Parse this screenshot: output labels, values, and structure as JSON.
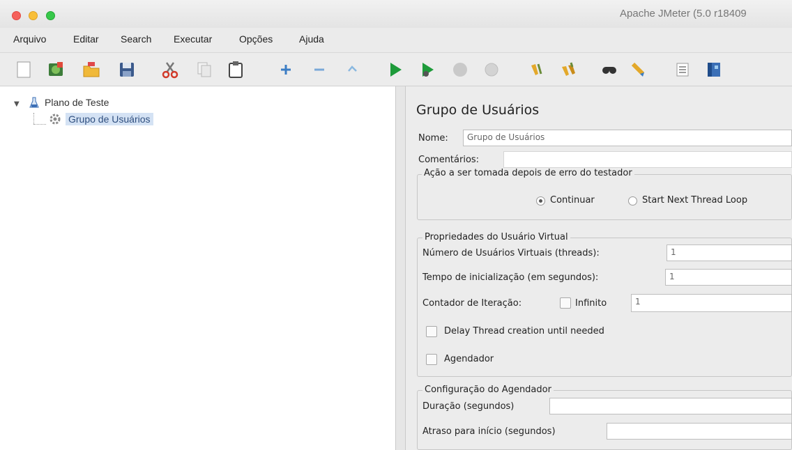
{
  "window": {
    "title": "Apache JMeter (5.0 r18409"
  },
  "menu": {
    "items": [
      {
        "label": "Arquivo"
      },
      {
        "label": "Editar"
      },
      {
        "label": "Search"
      },
      {
        "label": "Executar"
      },
      {
        "label": "Opções"
      },
      {
        "label": "Ajuda"
      }
    ]
  },
  "toolbar": {
    "icons": [
      "new-icon",
      "templates-icon",
      "open-icon",
      "save-icon",
      "cut-icon",
      "copy-icon",
      "paste-icon",
      "expand-icon",
      "collapse-icon",
      "toggle-icon",
      "start-icon",
      "start-no-pause-icon",
      "stop-icon",
      "shutdown-icon",
      "clear-icon",
      "clear-all-icon",
      "search-icon",
      "reset-search-icon",
      "function-helper-icon",
      "help-icon"
    ]
  },
  "tree": {
    "root": {
      "label": "Plano de Teste"
    },
    "child": {
      "label": "Grupo de Usuários"
    }
  },
  "panel": {
    "title": "Grupo de Usuários",
    "name_label": "Nome:",
    "name_value": "Grupo de Usuários",
    "comments_label": "Comentários:",
    "error_action": {
      "legend": "Ação a ser tomada depois de erro do testador",
      "continue_label": "Continuar",
      "next_loop_label": "Start Next Thread Loop"
    },
    "thread_props": {
      "legend": "Propriedades do Usuário Virtual",
      "threads_label": "Número de Usuários Virtuais (threads):",
      "threads_value": "1",
      "rampup_label": "Tempo de inicialização (em segundos):",
      "rampup_value": "1",
      "loop_label": "Contador de Iteração:",
      "infinite_label": "Infinito",
      "loop_value": "1",
      "delay_label": "Delay Thread creation until needed",
      "scheduler_label": "Agendador"
    },
    "scheduler_config": {
      "legend": "Configuração do Agendador",
      "duration_label": "Duração (segundos)",
      "delay_label": "Atraso para início (segundos)"
    }
  }
}
